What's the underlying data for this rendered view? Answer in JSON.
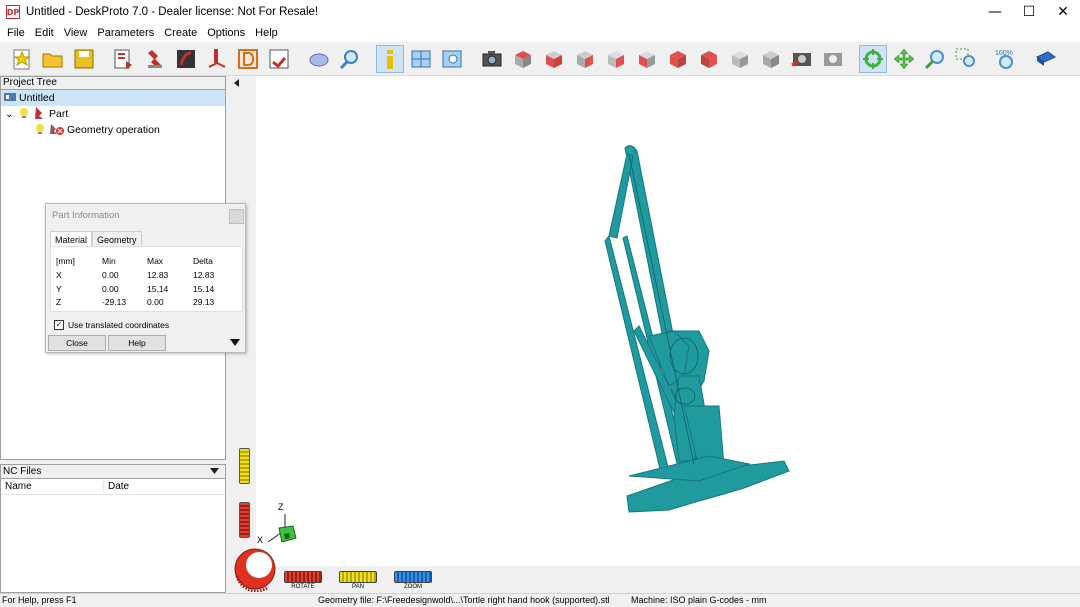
{
  "window": {
    "app_icon": "DP",
    "title": "Untitled - DeskProto 7.0 - Dealer license: Not For Resale!",
    "minimize": "—",
    "maximize": "☐",
    "close": "✕"
  },
  "menu": [
    "File",
    "Edit",
    "View",
    "Parameters",
    "Create",
    "Options",
    "Help"
  ],
  "toolbar": {
    "icons": [
      "new-project-icon",
      "open-project-icon",
      "save-project-icon",
      "load-geometry-icon",
      "part-icon",
      "vector-operation-icon",
      "bitmap-operation-icon",
      "drawing-icon",
      "write-nc-icon",
      "shaded-view-icon",
      "zoom-part-icon",
      "part-information-icon",
      "split-view-icon",
      "preview-icon",
      "camera-icon",
      "view-top-icon",
      "view-front-icon",
      "view-right-icon",
      "view-back-icon",
      "view-left-icon",
      "view-bottom-icon",
      "view-iso-icon",
      "view-iso2-icon",
      "screenshot-icon",
      "screenshot2-icon",
      "rotate-mode-icon",
      "pan-mode-icon",
      "zoom-mode-icon",
      "zoom-window-icon",
      "zoom-100-icon",
      "book-help-icon"
    ],
    "zoom_100_label": "100%"
  },
  "project_tree": {
    "header": "Project Tree",
    "items": [
      {
        "label": "Untitled",
        "icon": "project-icon"
      },
      {
        "label": "Part",
        "icon": "part-icon",
        "expander": "⌄"
      },
      {
        "label": "Geometry operation",
        "icon": "geometry-operation-icon"
      }
    ]
  },
  "nc_files": {
    "header": "NC Files",
    "columns": [
      "Name",
      "Date"
    ]
  },
  "part_info_dialog": {
    "title": "Part Information",
    "tabs": [
      "Material",
      "Geometry"
    ],
    "headers": [
      "[mm]",
      "Min",
      "Max",
      "Delta"
    ],
    "rows": [
      [
        "X",
        "0.00",
        "12.83",
        "12.83"
      ],
      [
        "Y",
        "0.00",
        "15.14",
        "15.14"
      ],
      [
        "Z",
        "-29.13",
        "0.00",
        "29.13"
      ]
    ],
    "checkbox_label": "Use translated coordinates",
    "checkbox_checked": true,
    "close_button": "Close",
    "help_button": "Help"
  },
  "viewport": {
    "axis_z": "Z",
    "axis_x": "X",
    "model_color": "#1f9a9e",
    "rotate_label": "ROTATE",
    "pan_label": "PAN",
    "zoom_label": "ZOOM"
  },
  "status": {
    "help": "For Help, press F1",
    "geometry": "Geometry file: F:\\Freedesignwold\\...\\Tortle right hand hook (supported).stl",
    "machine": "Machine: ISO plain G-codes - mm"
  }
}
